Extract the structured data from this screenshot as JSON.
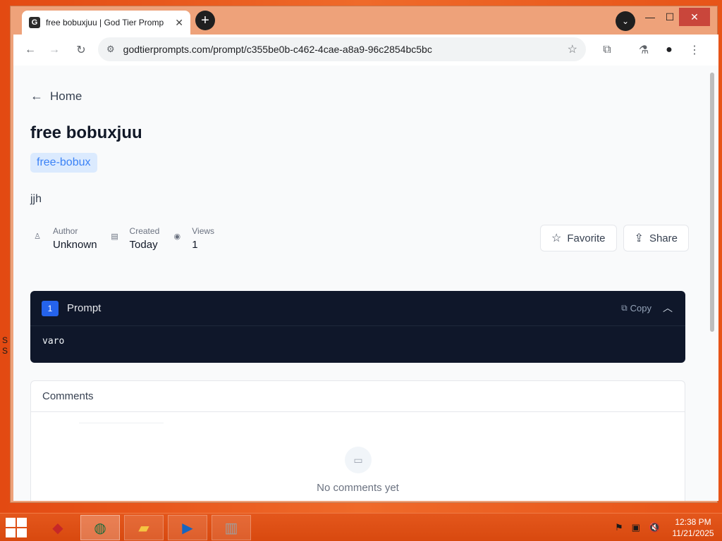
{
  "browser": {
    "tab_title": "free bobuxjuu | God Tier Promp",
    "tab_favicon": "G",
    "url": "godtierprompts.com/prompt/c355be0b-c462-4cae-a8a9-96c2854bc5bc",
    "new_tab_label": "+"
  },
  "page": {
    "back_label": "Home",
    "title": "free bobuxjuu",
    "tag": "free-bobux",
    "description": "jjh",
    "meta": {
      "author_label": "Author",
      "author_value": "Unknown",
      "created_label": "Created",
      "created_value": "Today",
      "views_label": "Views",
      "views_value": "1"
    },
    "actions": {
      "favorite_label": "Favorite",
      "share_label": "Share"
    },
    "prompt": {
      "number": "1",
      "label": "Prompt",
      "copy_label": "Copy",
      "text": "varo"
    },
    "comments": {
      "title": "Comments",
      "empty_text": "No comments yet"
    }
  },
  "taskbar": {
    "time": "12:38 PM",
    "date": "11/21/2025"
  },
  "desktop": {
    "fragments": [
      "S",
      "S"
    ]
  },
  "colors": {
    "accent": "#2563eb",
    "tag_bg": "#dbeafe",
    "prompt_bg": "#0f172a",
    "desktop": "#e85a1c"
  }
}
